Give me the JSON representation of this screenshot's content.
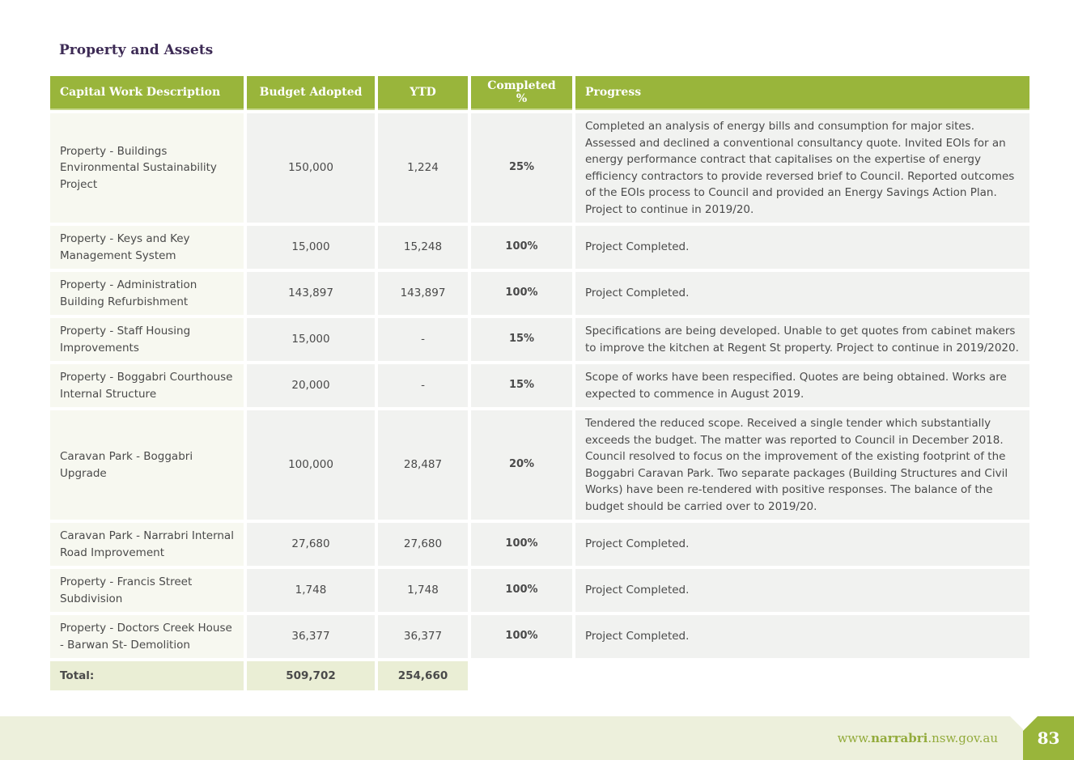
{
  "section_title": "Property and Assets",
  "columns": {
    "description": "Capital Work Description",
    "budget": "Budget Adopted",
    "ytd": "YTD",
    "completed": "Completed %",
    "progress": "Progress"
  },
  "rows": [
    {
      "description": "Property - Buildings Environmental Sustainability Project",
      "budget": "150,000",
      "ytd": "1,224",
      "completed": "25%",
      "progress": "Completed an analysis of energy bills and consumption for major sites. Assessed and declined a conventional consultancy quote. Invited EOIs for an energy performance contract that capitalises on the expertise of energy efficiency contractors to provide reversed brief to Council. Reported outcomes of the EOIs process to Council and provided an Energy Savings Action Plan. Project to continue in 2019/20."
    },
    {
      "description": "Property - Keys and Key Management System",
      "budget": "15,000",
      "ytd": "15,248",
      "completed": "100%",
      "progress": "Project Completed."
    },
    {
      "description": "Property - Administration Building Refurbishment",
      "budget": "143,897",
      "ytd": "143,897",
      "completed": "100%",
      "progress": "Project Completed."
    },
    {
      "description": "Property - Staff Housing Improvements",
      "budget": "15,000",
      "ytd": "-",
      "completed": "15%",
      "progress": "Specifications are being developed. Unable to get quotes from cabinet makers to improve the kitchen at Regent St property. Project to continue in 2019/2020."
    },
    {
      "description": "Property - Boggabri Courthouse Internal Structure",
      "budget": "20,000",
      "ytd": "-",
      "completed": "15%",
      "progress": "Scope of works have been respecified. Quotes are being obtained. Works are expected to commence in August 2019."
    },
    {
      "description": "Caravan Park - Boggabri Upgrade",
      "budget": "100,000",
      "ytd": "28,487",
      "completed": "20%",
      "progress": "Tendered the reduced scope. Received a single tender which substantially exceeds the budget.  The matter was reported to Council in December 2018. Council resolved to focus on the improvement of the existing footprint of the Boggabri Caravan Park. Two separate packages (Building Structures and Civil Works) have been re-tendered with positive responses. The balance of the budget should be carried over to 2019/20."
    },
    {
      "description": "Caravan Park - Narrabri Internal Road Improvement",
      "budget": "27,680",
      "ytd": "27,680",
      "completed": "100%",
      "progress": "Project Completed."
    },
    {
      "description": "Property - Francis Street Subdivision",
      "budget": "1,748",
      "ytd": "1,748",
      "completed": "100%",
      "progress": "Project Completed."
    },
    {
      "description": "Property - Doctors Creek House - Barwan St- Demolition",
      "budget": "36,377",
      "ytd": "36,377",
      "completed": "100%",
      "progress": "Project Completed."
    }
  ],
  "total": {
    "label": "Total:",
    "budget": "509,702",
    "ytd": "254,660"
  },
  "footer": {
    "website_prefix": "www.",
    "website_name": "narrabri",
    "website_suffix": ".nsw.gov.au",
    "page_number": "83"
  },
  "colors": {
    "header_green": "#99b53b",
    "in_progress_orange": "#e0743a",
    "completed_green": "#a8c256",
    "title_purple": "#3d2b55"
  }
}
